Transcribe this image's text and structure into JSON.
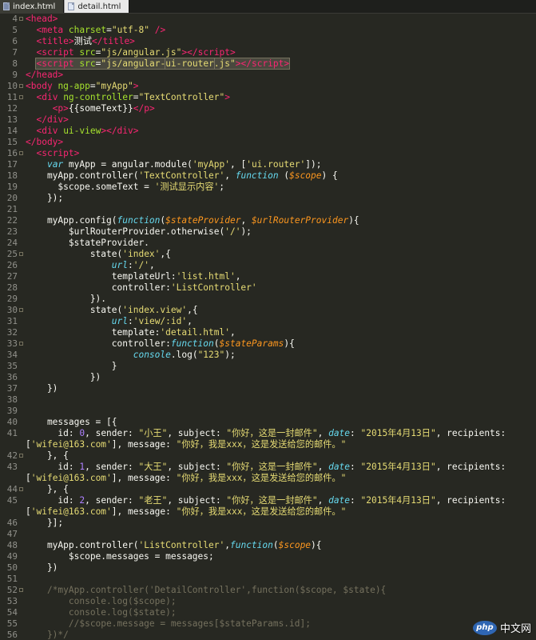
{
  "tabs": [
    {
      "label": "index.html",
      "active": true
    },
    {
      "label": "detail.html",
      "active": false
    }
  ],
  "lines": [
    {
      "n": "4",
      "fold": true,
      "html": "<span class='t'>&lt;head&gt;</span>"
    },
    {
      "n": "5",
      "fold": false,
      "html": "  <span class='t'>&lt;meta</span> <span class='a'>charset</span>=<span class='s'>\"utf-8\"</span> <span class='t'>/&gt;</span>"
    },
    {
      "n": "6",
      "fold": false,
      "html": "  <span class='t'>&lt;title&gt;</span>测试<span class='t'>&lt;/title&gt;</span>"
    },
    {
      "n": "7",
      "fold": false,
      "html": "  <span class='t'>&lt;script</span> <span class='a'>src</span>=<span class='s'>\"js/angular.js\"</span><span class='t'>&gt;&lt;/script&gt;</span>"
    },
    {
      "n": "8",
      "fold": false,
      "html": "  <span class='hl'><span class='t'>&lt;script</span> <span class='a'>src</span>=<span class='s'>\"js/angular-<span class='hl'>ui-router</span>.js\"</span><span class='t'>&gt;&lt;/script&gt;</span></span>"
    },
    {
      "n": "9",
      "fold": false,
      "html": "<span class='t'>&lt;/head&gt;</span>"
    },
    {
      "n": "10",
      "fold": true,
      "html": "<span class='t'>&lt;body</span> <span class='a'>ng-app</span>=<span class='s'>\"myApp\"</span><span class='t'>&gt;</span>"
    },
    {
      "n": "11",
      "fold": true,
      "html": "  <span class='t'>&lt;div</span> <span class='a'>ng-controller</span>=<span class='s'>\"TextController\"</span><span class='t'>&gt;</span>"
    },
    {
      "n": "12",
      "fold": false,
      "html": "     <span class='t'>&lt;p&gt;</span>{{someText}}<span class='t'>&lt;/p&gt;</span>"
    },
    {
      "n": "13",
      "fold": false,
      "html": "  <span class='t'>&lt;/div&gt;</span>"
    },
    {
      "n": "14",
      "fold": false,
      "html": "  <span class='t'>&lt;div</span> <span class='a'>ui-view</span><span class='t'>&gt;&lt;/div&gt;</span>"
    },
    {
      "n": "15",
      "fold": false,
      "html": "<span class='t'>&lt;/body&gt;</span>"
    },
    {
      "n": "16",
      "fold": true,
      "html": "  <span class='t'>&lt;script&gt;</span>"
    },
    {
      "n": "17",
      "fold": false,
      "html": "    <span class='k'>var</span> myApp = angular.module(<span class='s'>'myApp'</span>, [<span class='s'>'ui.router'</span>]);"
    },
    {
      "n": "18",
      "fold": false,
      "html": "    myApp.controller(<span class='s'>'TextController'</span>, <span class='k'>function</span> (<span class='p'>$scope</span>) {"
    },
    {
      "n": "19",
      "fold": false,
      "html": "      $scope.someText = <span class='s'>'测试显示内容'</span>;"
    },
    {
      "n": "20",
      "fold": false,
      "html": "    });"
    },
    {
      "n": "21",
      "fold": false,
      "html": ""
    },
    {
      "n": "22",
      "fold": false,
      "html": "    myApp.config(<span class='k'>function</span>(<span class='p'>$stateProvider</span>, <span class='p'>$urlRouterProvider</span>){"
    },
    {
      "n": "23",
      "fold": false,
      "html": "        $urlRouterProvider.otherwise(<span class='s'>'/'</span>);"
    },
    {
      "n": "24",
      "fold": false,
      "html": "        $stateProvider."
    },
    {
      "n": "25",
      "fold": true,
      "html": "            state(<span class='s'>'index'</span>,{"
    },
    {
      "n": "26",
      "fold": false,
      "html": "                <span class='k'>url</span>:<span class='s'>'/'</span>,"
    },
    {
      "n": "27",
      "fold": false,
      "html": "                templateUrl:<span class='s'>'list.html'</span>,"
    },
    {
      "n": "28",
      "fold": false,
      "html": "                controller:<span class='s'>'ListController'</span>"
    },
    {
      "n": "29",
      "fold": false,
      "html": "            })."
    },
    {
      "n": "30",
      "fold": true,
      "html": "            state(<span class='s'>'index.view'</span>,{"
    },
    {
      "n": "31",
      "fold": false,
      "html": "                <span class='k'>url</span>:<span class='s'>'view/:id'</span>,"
    },
    {
      "n": "32",
      "fold": false,
      "html": "                template:<span class='s'>'detail.html'</span>,"
    },
    {
      "n": "33",
      "fold": true,
      "html": "                controller:<span class='k'>function</span>(<span class='p'>$stateParams</span>){"
    },
    {
      "n": "34",
      "fold": false,
      "html": "                    <span class='k'>console</span>.log(<span class='s'>\"123\"</span>);"
    },
    {
      "n": "35",
      "fold": false,
      "html": "                }"
    },
    {
      "n": "36",
      "fold": false,
      "html": "            })"
    },
    {
      "n": "37",
      "fold": false,
      "html": "    })"
    },
    {
      "n": "38",
      "fold": false,
      "html": ""
    },
    {
      "n": "39",
      "fold": false,
      "html": ""
    },
    {
      "n": "40",
      "fold": false,
      "html": "    messages = [{"
    },
    {
      "n": "41",
      "fold": false,
      "html": "      id: <span class='n'>0</span>, sender: <span class='s'>\"小王\"</span>, subject: <span class='s'>\"你好，这是一封邮件\"</span>, <span class='k'>date</span>: <span class='s'>\"2015年4月13日\"</span>, recipients:"
    },
    {
      "n": "",
      "fold": false,
      "html": "[<span class='s'>'wifei@163.com'</span>], message: <span class='s'>\"你好，我是xxx，这是发送给您的邮件。\"</span>"
    },
    {
      "n": "42",
      "fold": true,
      "html": "    }, {"
    },
    {
      "n": "43",
      "fold": false,
      "html": "      id: <span class='n'>1</span>, sender: <span class='s'>\"大王\"</span>, subject: <span class='s'>\"你好，这是一封邮件\"</span>, <span class='k'>date</span>: <span class='s'>\"2015年4月13日\"</span>, recipients:"
    },
    {
      "n": "",
      "fold": false,
      "html": "[<span class='s'>'wifei@163.com'</span>], message: <span class='s'>\"你好，我是xxx，这是发送给您的邮件。\"</span>"
    },
    {
      "n": "44",
      "fold": true,
      "html": "    }, {"
    },
    {
      "n": "45",
      "fold": false,
      "html": "      id: <span class='n'>2</span>, sender: <span class='s'>\"老王\"</span>, subject: <span class='s'>\"你好，这是一封邮件\"</span>, <span class='k'>date</span>: <span class='s'>\"2015年4月13日\"</span>, recipients:"
    },
    {
      "n": "",
      "fold": false,
      "html": "[<span class='s'>'wifei@163.com'</span>], message: <span class='s'>\"你好，我是xxx，这是发送给您的邮件。\"</span>"
    },
    {
      "n": "46",
      "fold": false,
      "html": "    }];"
    },
    {
      "n": "47",
      "fold": false,
      "html": ""
    },
    {
      "n": "48",
      "fold": false,
      "html": "    myApp.controller(<span class='s'>'ListController'</span>,<span class='k'>function</span>(<span class='p'>$scope</span>){"
    },
    {
      "n": "49",
      "fold": false,
      "html": "        $scope.messages = messages;"
    },
    {
      "n": "50",
      "fold": false,
      "html": "    })"
    },
    {
      "n": "51",
      "fold": false,
      "html": ""
    },
    {
      "n": "52",
      "fold": true,
      "html": "    <span class='c'>/*myApp.controller('DetailController',function($scope, $state){</span>"
    },
    {
      "n": "53",
      "fold": false,
      "html": "<span class='c'>        console.log($scope);</span>"
    },
    {
      "n": "54",
      "fold": false,
      "html": "<span class='c'>        console.log($state);</span>"
    },
    {
      "n": "55",
      "fold": false,
      "html": "<span class='c'>        //$scope.message = messages[$stateParams.id];</span>"
    },
    {
      "n": "56",
      "fold": false,
      "html": "<span class='c'>    })*/</span>"
    }
  ],
  "watermark": {
    "logo": "php",
    "text": "中文网"
  }
}
